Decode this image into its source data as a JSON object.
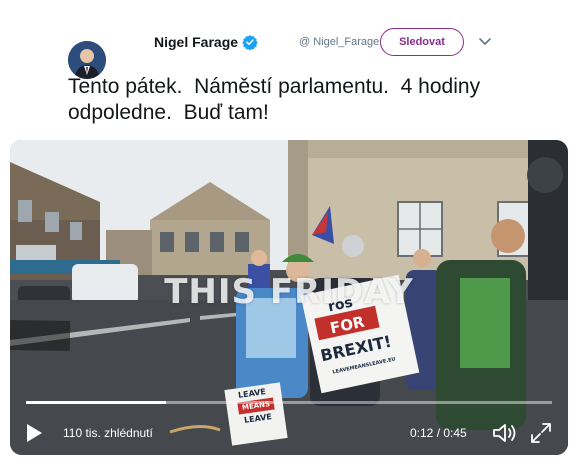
{
  "author": {
    "name": "Nigel Farage",
    "handle": "@ Nigel_Farage",
    "verified_icon": "verified-badge-icon",
    "avatar_icon": "avatar"
  },
  "follow_button": {
    "label": "Sledovat",
    "color": "#8a2c8f"
  },
  "more_icon": "chevron-down-icon",
  "tweet": {
    "text": "Tento pátek.  Náměstí parlamentu.  4 hodiny odpoledne.  Buď tam!"
  },
  "video": {
    "overlay_caption": "THIS FRIDAY",
    "sign_main_line1": "ros",
    "sign_main_line2": "FOR",
    "sign_main_line3": "BREXIT!",
    "sign_main_url": "LEAVEMEANSLEAVE.EU",
    "sign_small_line1": "LEAVE",
    "sign_small_line2": "MEANS",
    "sign_small_line3": "LEAVE",
    "progress": 0.267,
    "views": "110 tis. zhlédnutí",
    "time": "0:12 / 0:45",
    "play_icon": "play-icon",
    "volume_icon": "volume-icon",
    "fullscreen_icon": "fullscreen-icon"
  }
}
